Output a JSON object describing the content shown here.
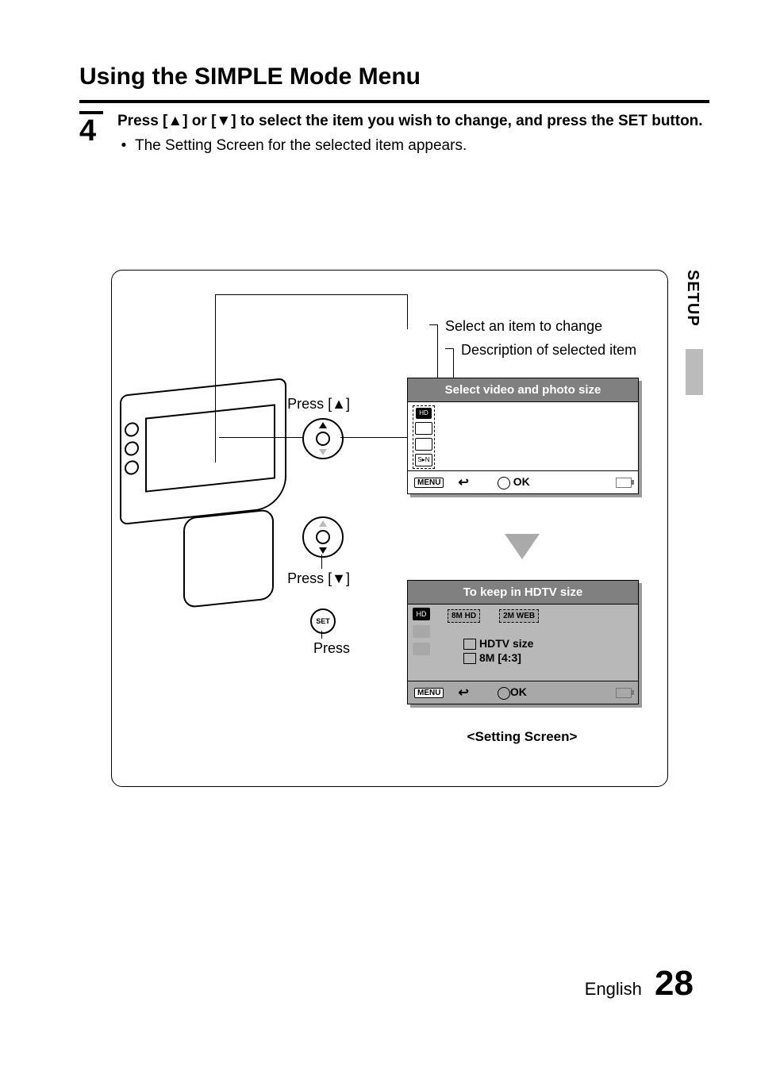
{
  "title": "Using the SIMPLE Mode Menu",
  "step": {
    "number": "4",
    "text_bold_1": "Press [",
    "tri_up": "▲",
    "text_bold_2": "] or [",
    "tri_down": "▼",
    "text_bold_3": "] to select the item you wish to change, and press the SET button.",
    "bullet": "•",
    "sub": "The Setting Screen for the selected item appears."
  },
  "side_tab": "SETUP",
  "annotations": {
    "select_item": "Select an item to change",
    "description_item": "Description of selected item",
    "press_up": "Press [▲]",
    "press_down": "Press [▼]",
    "press": "Press",
    "setting_caption": "<Setting Screen>"
  },
  "screen1": {
    "header": "Select video and photo size",
    "icons": [
      "HD",
      "",
      "",
      "S▸N"
    ],
    "menu": "MENU",
    "return_sym": "↩",
    "ok": "OK"
  },
  "screen2": {
    "header": "To keep in HDTV size",
    "icons": [
      "HD",
      "",
      ""
    ],
    "opt1": "8M HD",
    "opt2": "2M WEB",
    "line1": "HDTV size",
    "line2": "8M [4:3]",
    "menu": "MENU",
    "return_sym": "↩",
    "ok": "OK"
  },
  "footer": {
    "language": "English",
    "page_number": "28"
  }
}
